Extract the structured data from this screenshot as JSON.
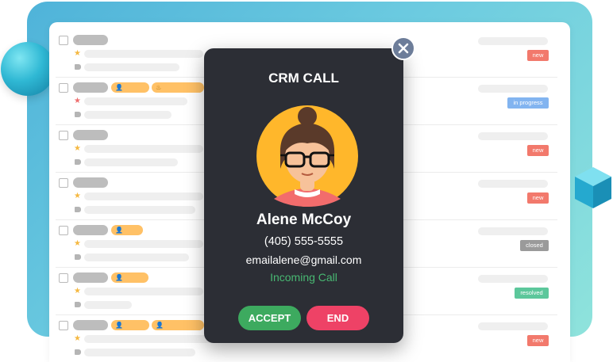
{
  "modal": {
    "title": "CRM CALL",
    "caller_name": "Alene McCoy",
    "phone": "(405) 555-5555",
    "email": "emailalene@gmail.com",
    "status": "Incoming Call",
    "accept_label": "ACCEPT",
    "end_label": "END",
    "close_icon": "close-icon"
  },
  "tickets": [
    {
      "status": "new",
      "status_color": "#f2796c",
      "star": "gold",
      "chips": []
    },
    {
      "status": "in progress",
      "status_color": "#82b4f0",
      "star": "red",
      "chips": [
        "user-icon",
        "fire-icon"
      ]
    },
    {
      "status": "new",
      "status_color": "#f2796c",
      "star": "gold",
      "chips": []
    },
    {
      "status": "new",
      "status_color": "#f2796c",
      "star": "gold",
      "chips": []
    },
    {
      "status": "closed",
      "status_color": "#9a9a9a",
      "star": "gold",
      "chips": [
        "user-icon"
      ]
    },
    {
      "status": "resolved",
      "status_color": "#5cc79b",
      "star": "gold",
      "chips": [
        "user-icon"
      ]
    },
    {
      "status": "new",
      "status_color": "#f2796c",
      "star": "gold",
      "chips": [
        "user-icon",
        "user-icon"
      ]
    }
  ],
  "colors": {
    "accent_gradient_start": "#4fb3d9",
    "accent_gradient_end": "#8fe3dc",
    "modal_bg": "#2c2e35",
    "accept": "#3daa5f",
    "end": "#ee4266",
    "incoming": "#48b872"
  }
}
